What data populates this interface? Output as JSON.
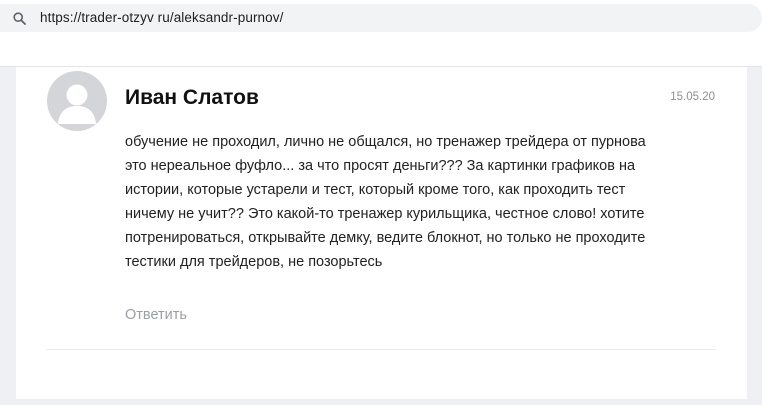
{
  "browser": {
    "url": "https://trader-otzyv ru/aleksandr-purnov/"
  },
  "comment": {
    "author": "Иван Слатов",
    "date": "15.05.20",
    "text_lines": [
      "обучение не проходил, лично не общался, но тренажер трейдера от пурнова",
      "это нереальное фуфло... за что просят деньги??? За картинки графиков на",
      "истории, которые устарели и тест, который кроме того, как проходить тест",
      "ничему не учит?? Это какой-то тренажер курильщика, честное слово! хотите",
      "потренироваться, открывайте демку, ведите блокнот, но только не проходите",
      "тестики для трейдеров, не позорьтесь"
    ],
    "reply_label": "Ответить"
  }
}
